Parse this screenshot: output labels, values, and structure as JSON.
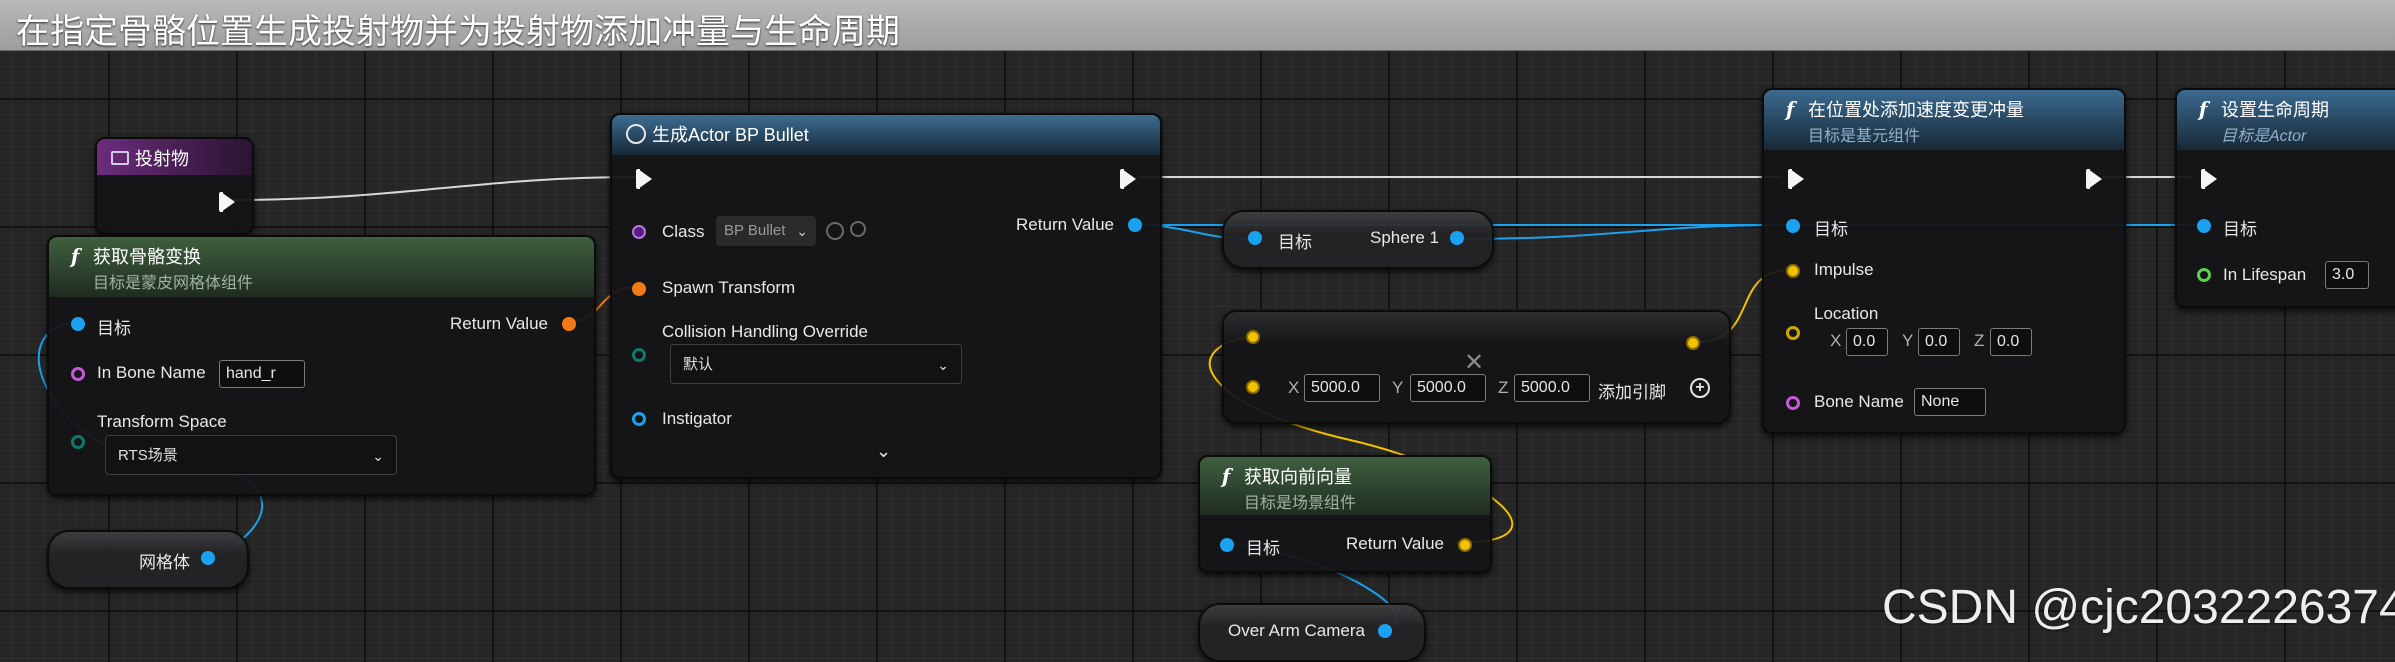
{
  "title": "在指定骨骼位置生成投射物并为投射物添加冲量与生命周期",
  "colors": {
    "object_pin": "#1aa2f0",
    "transform_pin": "#f07b14",
    "name_pin": "#c35bd8",
    "vector_pin": "#f4c100",
    "float_pin": "#5cd04a",
    "exec_pin": "#f5f5f5",
    "function_header": "#3f5f3f",
    "spawn_header": "#3d6d92",
    "variable_header": "#6b2c7c"
  },
  "nodes": {
    "projectile_var": {
      "title": "投射物"
    },
    "get_socket_transform": {
      "title": "获取骨骼变换",
      "subtitle": "目标是蒙皮网格体组件",
      "target": "目标",
      "return_value": "Return Value",
      "in_bone_name": "In Bone Name",
      "in_bone_name_value": "hand_r",
      "transform_space": "Transform Space",
      "transform_space_value": "RTS场景"
    },
    "mesh_var": {
      "label": "网格体"
    },
    "spawn_actor": {
      "title": "生成Actor BP Bullet",
      "class_label": "Class",
      "class_value": "BP Bullet",
      "return_value": "Return Value",
      "spawn_transform": "Spawn Transform",
      "collision": "Collision Handling Override",
      "collision_value": "默认",
      "instigator": "Instigator"
    },
    "sphere_ref": {
      "target": "目标",
      "value": "Sphere 1"
    },
    "multiply": {
      "x_label": "X",
      "x_value": "5000.0",
      "y_label": "Y",
      "y_value": "5000.0",
      "z_label": "Z",
      "z_value": "5000.0",
      "add_pin": "添加引脚"
    },
    "forward_vector": {
      "title": "获取向前向量",
      "subtitle": "目标是场景组件",
      "target": "目标",
      "return_value": "Return Value"
    },
    "camera_var": {
      "label": "Over Arm Camera"
    },
    "add_impulse": {
      "title": "在位置处添加速度变更冲量",
      "subtitle": "目标是基元组件",
      "target": "目标",
      "impulse": "Impulse",
      "location": "Location",
      "lx_label": "X",
      "lx_value": "0.0",
      "ly_label": "Y",
      "ly_value": "0.0",
      "lz_label": "Z",
      "lz_value": "0.0",
      "bone_name": "Bone Name",
      "bone_name_value": "None"
    },
    "set_lifespan": {
      "title": "设置生命周期",
      "subtitle": "目标是Actor",
      "target": "目标",
      "in_lifespan": "In Lifespan",
      "in_lifespan_value": "3.0"
    }
  },
  "watermark": "CSDN @cjc2032226374"
}
